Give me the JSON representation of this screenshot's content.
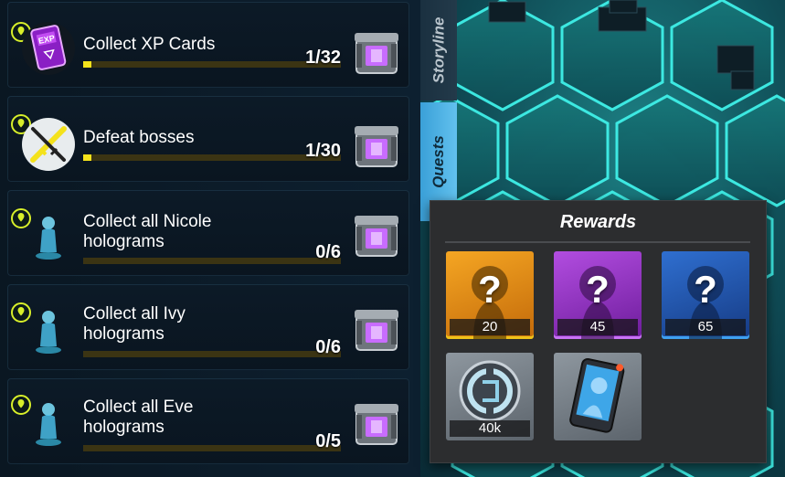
{
  "tabs": [
    {
      "label": "Storyline",
      "active": false
    },
    {
      "label": "Quests",
      "active": true
    }
  ],
  "quests": [
    {
      "title": "Collect XP Cards",
      "progress_text": "1/32",
      "progress": 0.031,
      "icon": "xp-card-icon"
    },
    {
      "title": "Defeat bosses",
      "progress_text": "1/30",
      "progress": 0.033,
      "icon": "crossed-swords-icon"
    },
    {
      "title": "Collect all Nicole holograms",
      "title_line1": "Collect all Nicole",
      "title_line2": "holograms",
      "progress_text": "0/6",
      "progress": 0,
      "icon": "hologram-icon"
    },
    {
      "title": "Collect all Ivy holograms",
      "title_line1": "Collect all Ivy",
      "title_line2": "holograms",
      "progress_text": "0/6",
      "progress": 0,
      "icon": "hologram-icon"
    },
    {
      "title": "Collect all Eve holograms",
      "title_line1": "Collect all Eve",
      "title_line2": "holograms",
      "progress_text": "0/5",
      "progress": 0,
      "icon": "hologram-icon"
    }
  ],
  "rewards": {
    "title": "Rewards",
    "items": [
      {
        "count": "20",
        "icon": "mystery-character-icon",
        "rarity_color": "#f0a21a"
      },
      {
        "count": "45",
        "icon": "mystery-character-icon",
        "rarity_color": "#a23fd2"
      },
      {
        "count": "65",
        "icon": "mystery-character-icon",
        "rarity_color": "#2f8fe0"
      },
      {
        "count": "40k",
        "icon": "coin-icon",
        "rarity_color": "#9aa2aa"
      },
      {
        "count": "",
        "icon": "hologram-card-icon",
        "rarity_color": "#9aa2aa"
      }
    ]
  },
  "colors": {
    "progress_fill": "#f4e21b",
    "progress_track": "#3b3413",
    "active_tab": "#4fb4e6",
    "crate_glow": "#c86cff"
  }
}
